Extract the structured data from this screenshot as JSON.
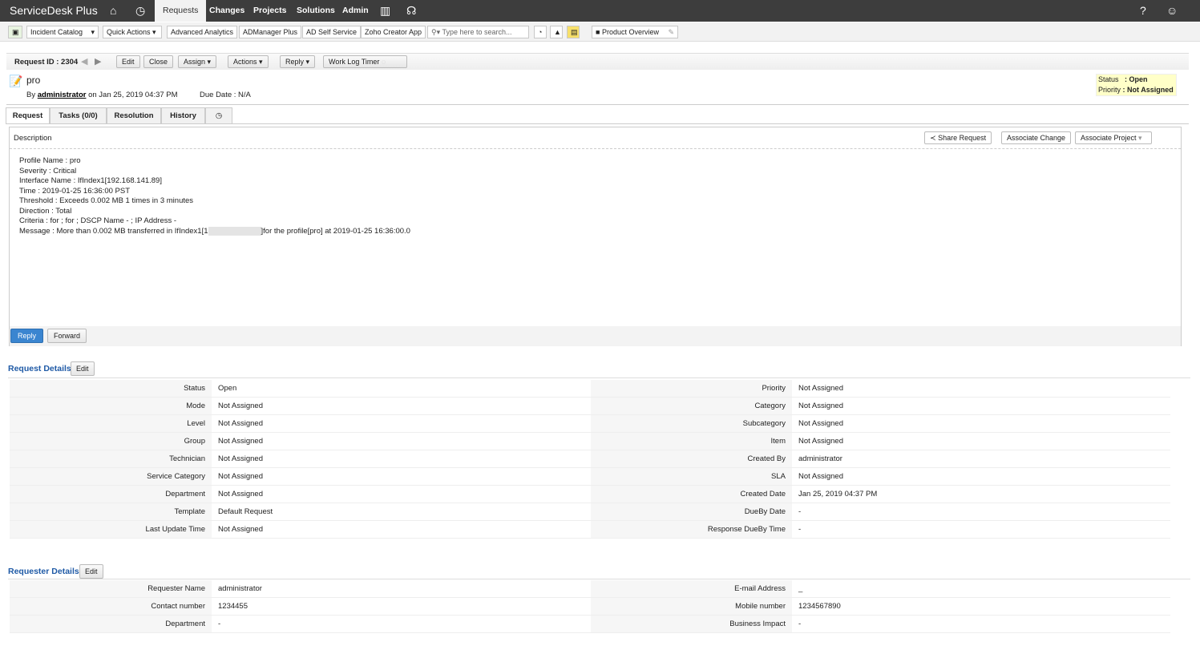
{
  "app": {
    "logo": "ServiceDesk Plus",
    "nav": [
      "Requests",
      "Changes",
      "Projects",
      "Solutions",
      "Admin"
    ]
  },
  "toolbar": {
    "items": [
      "Incident Catalog",
      "Quick Actions",
      "Advanced Analytics",
      "ADManager Plus",
      "AD Self Service",
      "Zoho Creator App"
    ],
    "search_placeholder": "Type here to search...",
    "product_overview": "Product Overview"
  },
  "request": {
    "id_label": "Request ID : 2304",
    "actions": [
      "Edit",
      "Close",
      "Assign",
      "Actions",
      "Reply",
      "Work Log Timer"
    ],
    "title": "pro",
    "by": "By",
    "author": "administrator",
    "on": "on  Jan 25, 2019 04:37 PM",
    "due": "Due Date : N/A",
    "status_label": "Status",
    "status_value": ": Open",
    "priority_label": "Priority",
    "priority_value": ": Not Assigned"
  },
  "tabs": [
    "Request",
    "Tasks (0/0)",
    "Resolution",
    "History"
  ],
  "description": {
    "title": "Description",
    "share": "Share Request",
    "assoc_change": "Associate Change",
    "assoc_project": "Associate Project",
    "lines": [
      "Profile Name : pro",
      "Severity : Critical",
      "Interface Name : IfIndex1[192.168.141.89]",
      "Time : 2019-01-25 16:36:00 PST",
      "Threshold : Exceeds 0.002 MB 1 times in 3 minutes",
      "Direction : Total",
      "Criteria : for ; for ; DSCP Name - ; IP Address -"
    ],
    "msg_a": "Message : More than 0.002 MB transferred in IfIndex1[1",
    "msg_b": "]for the profile[pro] at 2019-01-25 16:36:00.0",
    "reply": "Reply",
    "forward": "Forward"
  },
  "request_details": {
    "title": "Request Details",
    "edit": "Edit",
    "left": [
      [
        "Status",
        "Open"
      ],
      [
        "Mode",
        "Not Assigned"
      ],
      [
        "Level",
        "Not Assigned"
      ],
      [
        "Group",
        "Not Assigned"
      ],
      [
        "Technician",
        "Not Assigned"
      ],
      [
        "Service Category",
        "Not Assigned"
      ],
      [
        "Department",
        "Not Assigned"
      ],
      [
        "Template",
        "Default Request"
      ],
      [
        "Last Update Time",
        "Not Assigned"
      ]
    ],
    "right": [
      [
        "Priority",
        "Not Assigned"
      ],
      [
        "Category",
        "Not Assigned"
      ],
      [
        "Subcategory",
        "Not Assigned"
      ],
      [
        "Item",
        "Not Assigned"
      ],
      [
        "Created By",
        "administrator"
      ],
      [
        "SLA",
        "Not Assigned"
      ],
      [
        "Created Date",
        "Jan 25, 2019 04:37 PM"
      ],
      [
        "DueBy Date",
        "-"
      ],
      [
        "Response DueBy Time",
        "-"
      ]
    ]
  },
  "requester_details": {
    "title": "Requester Details",
    "edit": "Edit",
    "left": [
      [
        "Requester Name",
        "administrator"
      ],
      [
        "Contact number",
        "1234455"
      ],
      [
        "Department",
        "-"
      ]
    ],
    "right": [
      [
        "E-mail Address",
        "_"
      ],
      [
        "Mobile number",
        "1234567890"
      ],
      [
        "Business Impact",
        "-"
      ]
    ]
  }
}
